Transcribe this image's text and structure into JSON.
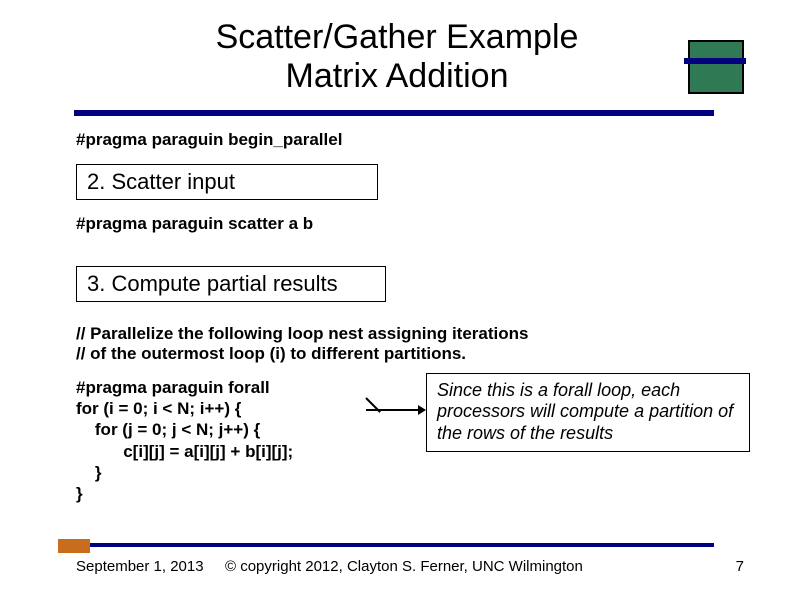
{
  "title_line1": "Scatter/Gather Example",
  "title_line2": "Matrix Addition",
  "pragma_begin": "#pragma paraguin begin_parallel",
  "step2_label": "2.  Scatter input",
  "pragma_scatter": "#pragma paraguin scatter a b",
  "step3_label": "3.  Compute partial results",
  "comment_line1": "// Parallelize the following loop nest assigning iterations",
  "comment_line2": "// of the outermost loop (i) to different partitions.",
  "code_line1": "#pragma paraguin forall",
  "code_line2": "for (i = 0; i < N; i++) {",
  "code_line3": "    for (j = 0; j < N; j++) {",
  "code_line4": "          c[i][j] = a[i][j] + b[i][j];",
  "code_line5": "    }",
  "code_line6": "}",
  "note_text": "Since this is a forall loop, each processors will compute a partition of the rows of the results",
  "footer_date": "September 1, 2013",
  "footer_copyright": "© copyright 2012, Clayton S. Ferner, UNC Wilmington",
  "footer_page": "7"
}
